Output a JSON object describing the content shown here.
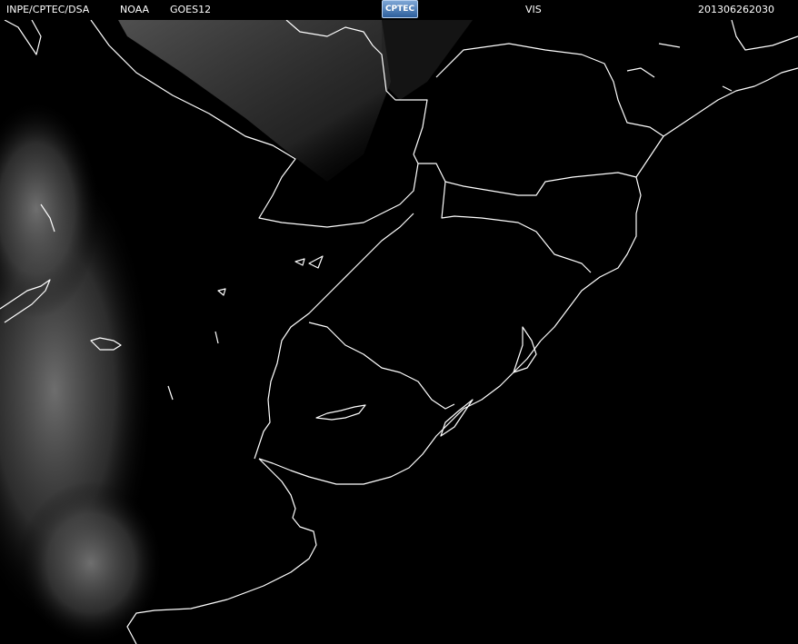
{
  "header": {
    "agency": "INPE/CPTEC/DSA",
    "source": "NOAA",
    "satellite": "GOES12",
    "logo_text": "CPTEC",
    "channel": "VIS",
    "timestamp": "201306262030"
  },
  "colors": {
    "background": "#000000",
    "borders": "#ffffff",
    "cloud": "#6b6b6b"
  }
}
